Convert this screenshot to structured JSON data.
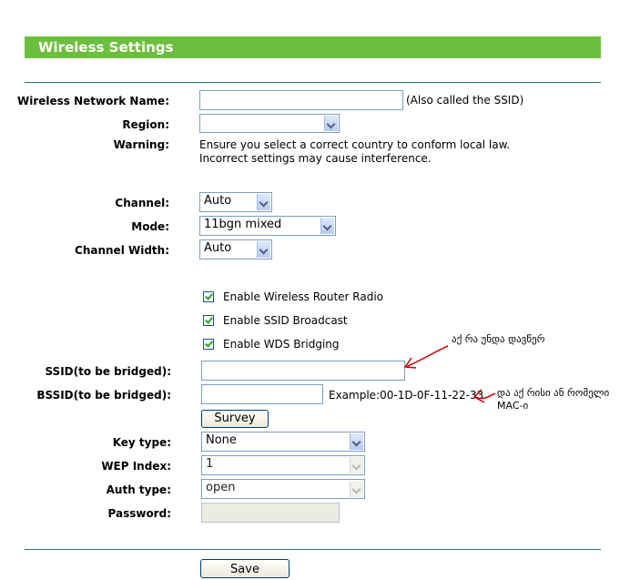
{
  "header": {
    "title": "Wireless Settings"
  },
  "form": {
    "ssid": {
      "label": "Wireless Network Name:",
      "value": "",
      "hint": "(Also called the SSID)"
    },
    "region": {
      "label": "Region:",
      "value": ""
    },
    "warning": {
      "label": "Warning:",
      "line1": "Ensure you select a correct country to conform local law.",
      "line2": "Incorrect settings may cause interference."
    },
    "channel": {
      "label": "Channel:",
      "value": "Auto"
    },
    "mode": {
      "label": "Mode:",
      "value": "11bgn mixed"
    },
    "channel_width": {
      "label": "Channel Width:",
      "value": "Auto"
    },
    "checkboxes": [
      {
        "label": "Enable Wireless Router Radio",
        "checked": true
      },
      {
        "label": "Enable SSID Broadcast",
        "checked": true
      },
      {
        "label": "Enable WDS Bridging",
        "checked": true
      }
    ],
    "wds_ssid": {
      "label": "SSID(to be bridged):",
      "value": ""
    },
    "wds_bssid": {
      "label": "BSSID(to be bridged):",
      "value": "",
      "example": "Example:00-1D-0F-11-22-33"
    },
    "survey_button": "Survey",
    "key_type": {
      "label": "Key type:",
      "value": "None"
    },
    "wep_index": {
      "label": "WEP Index:",
      "value": "1"
    },
    "auth_type": {
      "label": "Auth type:",
      "value": "open"
    },
    "password": {
      "label": "Password:",
      "value": ""
    },
    "save_button": "Save"
  },
  "annotations": {
    "note1": "აქ რა უნდა დავწერ",
    "note2_line1": "და აქ რისი ან რომელი",
    "note2_line2": "MAC-ი",
    "arrow_color": "#cc0000"
  },
  "colors": {
    "header": "#6cbf3d",
    "divider": "#2e7d5b"
  }
}
